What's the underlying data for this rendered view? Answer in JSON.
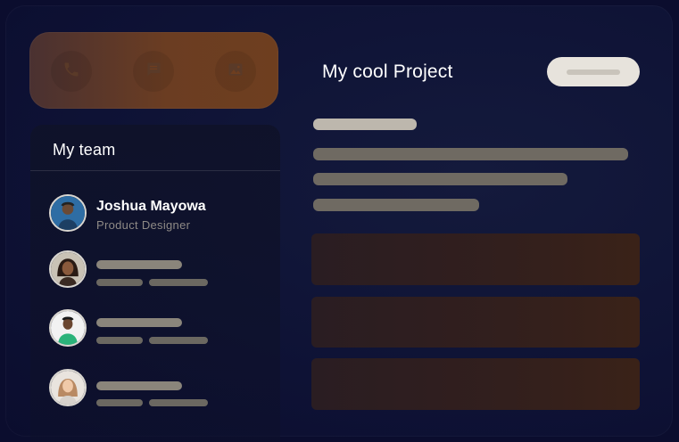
{
  "toolbar": {
    "items": [
      {
        "icon": "phone-icon"
      },
      {
        "icon": "message-icon"
      },
      {
        "icon": "image-icon"
      }
    ],
    "accent": "#6b3d22"
  },
  "team": {
    "header": "My team",
    "members": [
      {
        "name": "Joshua Mayowa",
        "role": "Product Designer",
        "avatar": "avatar-joshua"
      },
      {
        "name": "",
        "role": "",
        "avatar": "avatar-woman-1"
      },
      {
        "name": "",
        "role": "",
        "avatar": "avatar-man-green"
      },
      {
        "name": "",
        "role": "",
        "avatar": "avatar-woman-2"
      }
    ]
  },
  "project": {
    "title": "My cool Project",
    "action_button_label": "",
    "card_color": "#321f1d"
  }
}
